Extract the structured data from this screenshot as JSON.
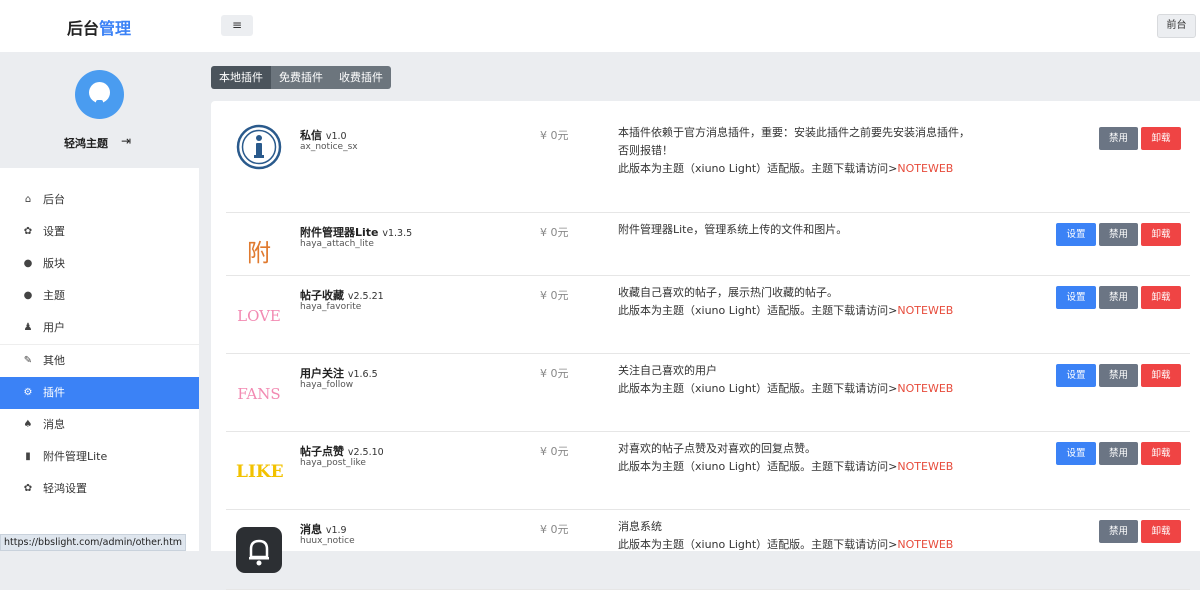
{
  "header": {
    "logo_part1": "后台",
    "logo_part2": "管理",
    "menu_icon": "≡",
    "front_label": "前台"
  },
  "sidebar": {
    "username": "轻鸿主题",
    "logout_icon": "⇥",
    "items": [
      {
        "icon": "home-icon",
        "glyph": "⌂",
        "label": "后台"
      },
      {
        "icon": "gear-icon",
        "glyph": "✿",
        "label": "设置"
      },
      {
        "icon": "comment-icon",
        "glyph": "●",
        "label": "版块"
      },
      {
        "icon": "comment-icon",
        "glyph": "●",
        "label": "主题"
      },
      {
        "icon": "user-icon",
        "glyph": "♟",
        "label": "用户"
      },
      {
        "icon": "wrench-icon",
        "glyph": "✎",
        "label": "其他"
      },
      {
        "icon": "gears-icon",
        "glyph": "⚙",
        "label": "插件"
      },
      {
        "icon": "bell-icon",
        "glyph": "♠",
        "label": "消息"
      },
      {
        "icon": "file-icon",
        "glyph": "▮",
        "label": "附件管理Lite"
      },
      {
        "icon": "gear-icon",
        "glyph": "✿",
        "label": "轻鸿设置"
      }
    ],
    "active_index": 6
  },
  "status_bar": "https://bbslight.com/admin/other.htm",
  "tabs": [
    "本地插件",
    "免费插件",
    "收费插件"
  ],
  "active_tab": 0,
  "buttons": {
    "settings": "设置",
    "disable": "禁用",
    "uninstall": "卸载"
  },
  "plugins": [
    {
      "name": "私信",
      "version": "v1.0",
      "id": "ax_notice_sx",
      "price": "¥ 0元",
      "logo": "info-icon",
      "logo_text": "i",
      "desc": [
        "本插件依赖于官方消息插件，重要：安装此插件之前要先安装消息插件，",
        "否则报错！",
        "此版本为主题（xiuno Light）适配版。主题下载请访问>"
      ],
      "link": "NOTEWEB",
      "has_settings": false
    },
    {
      "name": "附件管理器Lite",
      "version": "v1.3.5",
      "id": "haya_attach_lite",
      "price": "¥ 0元",
      "logo": "attach-logo",
      "logo_text": "附",
      "desc": [
        "附件管理器Lite，管理系统上传的文件和图片。"
      ],
      "link": "",
      "has_settings": true
    },
    {
      "name": "帖子收藏",
      "version": "v2.5.21",
      "id": "haya_favorite",
      "price": "¥ 0元",
      "logo": "love-logo",
      "logo_text": "LOVE",
      "desc": [
        "收藏自己喜欢的帖子，展示热门收藏的帖子。",
        "此版本为主题（xiuno Light）适配版。主题下载请访问>"
      ],
      "link": "NOTEWEB",
      "has_settings": true
    },
    {
      "name": "用户关注",
      "version": "v1.6.5",
      "id": "haya_follow",
      "price": "¥ 0元",
      "logo": "fans-logo",
      "logo_text": "FANS",
      "desc": [
        "关注自己喜欢的用户",
        "此版本为主题（xiuno Light）适配版。主题下载请访问>"
      ],
      "link": "NOTEWEB",
      "has_settings": true
    },
    {
      "name": "帖子点赞",
      "version": "v2.5.10",
      "id": "haya_post_like",
      "price": "¥ 0元",
      "logo": "like-logo",
      "logo_text": "LIKE",
      "desc": [
        "对喜欢的帖子点赞及对喜欢的回复点赞。",
        "此版本为主题（xiuno Light）适配版。主题下载请访问>"
      ],
      "link": "NOTEWEB",
      "has_settings": true
    },
    {
      "name": "消息",
      "version": "v1.9",
      "id": "huux_notice",
      "price": "¥ 0元",
      "logo": "bell-logo",
      "logo_text": "",
      "desc": [
        "消息系统",
        "此版本为主题（xiuno Light）适配版。主题下载请访问>"
      ],
      "link": "NOTEWEB",
      "has_settings": false
    }
  ],
  "colors": {
    "accent": "#3b82f6",
    "danger": "#ef4444",
    "muted": "#6b7584",
    "link": "#e74c3c"
  }
}
